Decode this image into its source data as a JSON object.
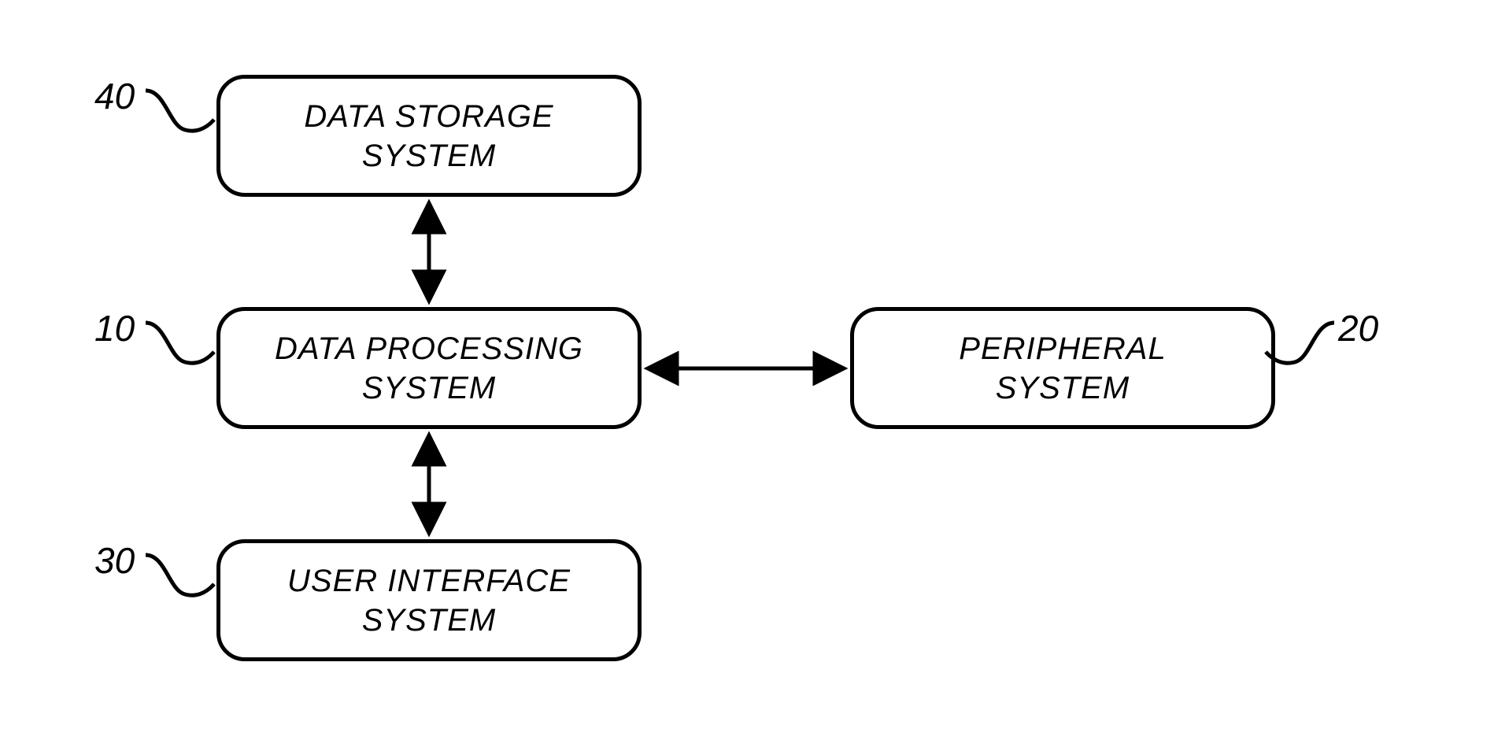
{
  "boxes": {
    "data_storage": {
      "label": "DATA STORAGE\nSYSTEM",
      "ref": "40"
    },
    "data_processing": {
      "label": "DATA PROCESSING\nSYSTEM",
      "ref": "10"
    },
    "user_interface": {
      "label": "USER INTERFACE\nSYSTEM",
      "ref": "30"
    },
    "peripheral": {
      "label": "PERIPHERAL\nSYSTEM",
      "ref": "20"
    }
  }
}
